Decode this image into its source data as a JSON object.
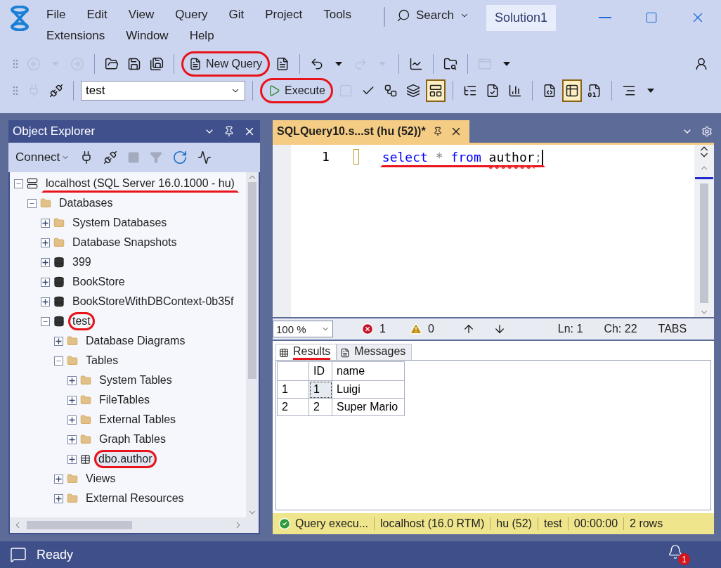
{
  "menu": [
    "File",
    "Edit",
    "View",
    "Query",
    "Git",
    "Project",
    "Tools",
    "Extensions",
    "Window",
    "Help"
  ],
  "search": {
    "label": "Search"
  },
  "solution": "Solution1",
  "toolbar1": [
    [
      {
        "kind": "back",
        "disabled": true
      },
      {
        "kind": "caret",
        "disabled": true
      },
      {
        "kind": "forward",
        "disabled": true
      }
    ],
    [
      {
        "kind": "open",
        "disabled": false
      },
      {
        "kind": "save",
        "disabled": false
      },
      {
        "kind": "saveall",
        "disabled": false
      }
    ],
    [
      {
        "kind": "newquery",
        "label": "New Query",
        "circled": true
      },
      {
        "kind": "dbquery",
        "disabled": false
      }
    ],
    [
      {
        "kind": "undo",
        "disabled": false
      },
      {
        "kind": "caret",
        "disabled": false
      },
      {
        "kind": "redo",
        "disabled": true
      },
      {
        "kind": "caret",
        "disabled": true
      }
    ],
    [
      {
        "kind": "monitor",
        "disabled": false
      }
    ],
    [
      {
        "kind": "foldersearch",
        "disabled": false
      }
    ],
    [
      {
        "kind": "window",
        "disabled": true
      },
      {
        "kind": "overflow",
        "disabled": false
      }
    ]
  ],
  "toolbar2": [
    [
      {
        "kind": "plug",
        "disabled": true,
        "pressed": false
      },
      {
        "kind": "plugedit",
        "disabled": false,
        "pressed": false
      }
    ],
    [
      {
        "kind": "select",
        "value": "test"
      }
    ],
    [
      {
        "kind": "execute",
        "label": "Execute",
        "circled": true
      },
      {
        "kind": "stop",
        "disabled": true,
        "pressed": false
      },
      {
        "kind": "check",
        "disabled": false,
        "pressed": false
      },
      {
        "kind": "plan",
        "disabled": false,
        "pressed": false
      },
      {
        "kind": "windows",
        "disabled": false,
        "pressed": false
      },
      {
        "kind": "pane",
        "disabled": false,
        "pressed": true
      }
    ],
    [
      {
        "kind": "flow",
        "disabled": false,
        "pressed": false
      },
      {
        "kind": "flowcheck",
        "disabled": false,
        "pressed": false
      },
      {
        "kind": "stats",
        "disabled": false,
        "pressed": false
      }
    ],
    [
      {
        "kind": "totext",
        "disabled": false,
        "pressed": false
      },
      {
        "kind": "togrid",
        "disabled": false,
        "pressed": true
      },
      {
        "kind": "tofile",
        "disabled": false,
        "pressed": false
      }
    ],
    [
      {
        "kind": "indent",
        "disabled": false,
        "pressed": false
      },
      {
        "kind": "overflow",
        "disabled": false,
        "pressed": false
      }
    ]
  ],
  "object_explorer": {
    "title": "Object Explorer",
    "connect": "Connect",
    "tree": [
      {
        "label": "localhost (SQL Server 16.0.1000 - hu)",
        "kind": "server",
        "expanded": true,
        "selected": false,
        "underlined": true,
        "circled": false,
        "children": [
          {
            "label": "Databases",
            "kind": "folder",
            "expanded": true,
            "selected": false,
            "underlined": false,
            "circled": false,
            "children": [
              {
                "label": "System Databases",
                "kind": "folder",
                "expanded": false,
                "selected": false,
                "underlined": false,
                "circled": false
              },
              {
                "label": "Database Snapshots",
                "kind": "folder",
                "expanded": false,
                "selected": false,
                "underlined": false,
                "circled": false
              },
              {
                "label": "399",
                "kind": "database",
                "expanded": false,
                "selected": false,
                "underlined": false,
                "circled": false
              },
              {
                "label": "BookStore",
                "kind": "database",
                "expanded": false,
                "selected": false,
                "underlined": false,
                "circled": false
              },
              {
                "label": "BookStoreWithDBContext-0b35f",
                "kind": "database",
                "expanded": false,
                "selected": false,
                "underlined": false,
                "circled": false
              },
              {
                "label": "test",
                "kind": "database",
                "expanded": true,
                "selected": false,
                "underlined": false,
                "circled": true,
                "children": [
                  {
                    "label": "Database Diagrams",
                    "kind": "folder",
                    "expanded": false,
                    "selected": false,
                    "underlined": false,
                    "circled": false
                  },
                  {
                    "label": "Tables",
                    "kind": "folder",
                    "expanded": true,
                    "selected": false,
                    "underlined": false,
                    "circled": false,
                    "children": [
                      {
                        "label": "System Tables",
                        "kind": "folder",
                        "expanded": false,
                        "selected": false,
                        "underlined": false,
                        "circled": false
                      },
                      {
                        "label": "FileTables",
                        "kind": "folder",
                        "expanded": false,
                        "selected": false,
                        "underlined": false,
                        "circled": false
                      },
                      {
                        "label": "External Tables",
                        "kind": "folder",
                        "expanded": false,
                        "selected": false,
                        "underlined": false,
                        "circled": false
                      },
                      {
                        "label": "Graph Tables",
                        "kind": "folder",
                        "expanded": false,
                        "selected": false,
                        "underlined": false,
                        "circled": false
                      },
                      {
                        "label": "dbo.author",
                        "kind": "table",
                        "expanded": false,
                        "selected": true,
                        "underlined": false,
                        "circled": true
                      }
                    ]
                  },
                  {
                    "label": "Views",
                    "kind": "folder",
                    "expanded": false,
                    "selected": false,
                    "underlined": false,
                    "circled": false
                  },
                  {
                    "label": "External Resources",
                    "kind": "folder",
                    "expanded": false,
                    "selected": false,
                    "underlined": false,
                    "circled": false
                  }
                ]
              }
            ]
          }
        ]
      }
    ]
  },
  "editor": {
    "tab": {
      "title": "SQLQuery10.s...st (hu (52))*",
      "selected": true
    },
    "line_number": "1",
    "code": [
      {
        "text": "select ",
        "kind": "keyword"
      },
      {
        "text": "* ",
        "kind": "operator"
      },
      {
        "text": "from ",
        "kind": "keyword"
      },
      {
        "text": "author",
        "kind": "error"
      },
      {
        "text": ";",
        "kind": "punct"
      }
    ],
    "code_underlined": true,
    "zoom": "100 %",
    "errors": "1",
    "warnings": "0",
    "line": "Ln: 1",
    "column": "Ch: 22",
    "indent_mode": "TABS"
  },
  "results": {
    "tabs": [
      {
        "label": "Results",
        "selected": true,
        "underlined": true
      },
      {
        "label": "Messages",
        "selected": false,
        "underlined": false
      }
    ],
    "columns": [
      "ID",
      "name"
    ],
    "rows": [
      {
        "number": "1",
        "cells": [
          {
            "text": "1",
            "selected": true
          },
          {
            "text": "Luigi",
            "selected": false
          }
        ]
      },
      {
        "number": "2",
        "cells": [
          {
            "text": "2",
            "selected": false
          },
          {
            "text": "Super Mario",
            "selected": false
          }
        ]
      }
    ]
  },
  "query_status": {
    "message": "Query  execu...",
    "server": "localhost (16.0 RTM)",
    "user": "hu (52)",
    "database": "test",
    "elapsed": "00:00:00",
    "rows": "2 rows"
  },
  "status_bar": {
    "text": "Ready",
    "notifications": "1"
  }
}
